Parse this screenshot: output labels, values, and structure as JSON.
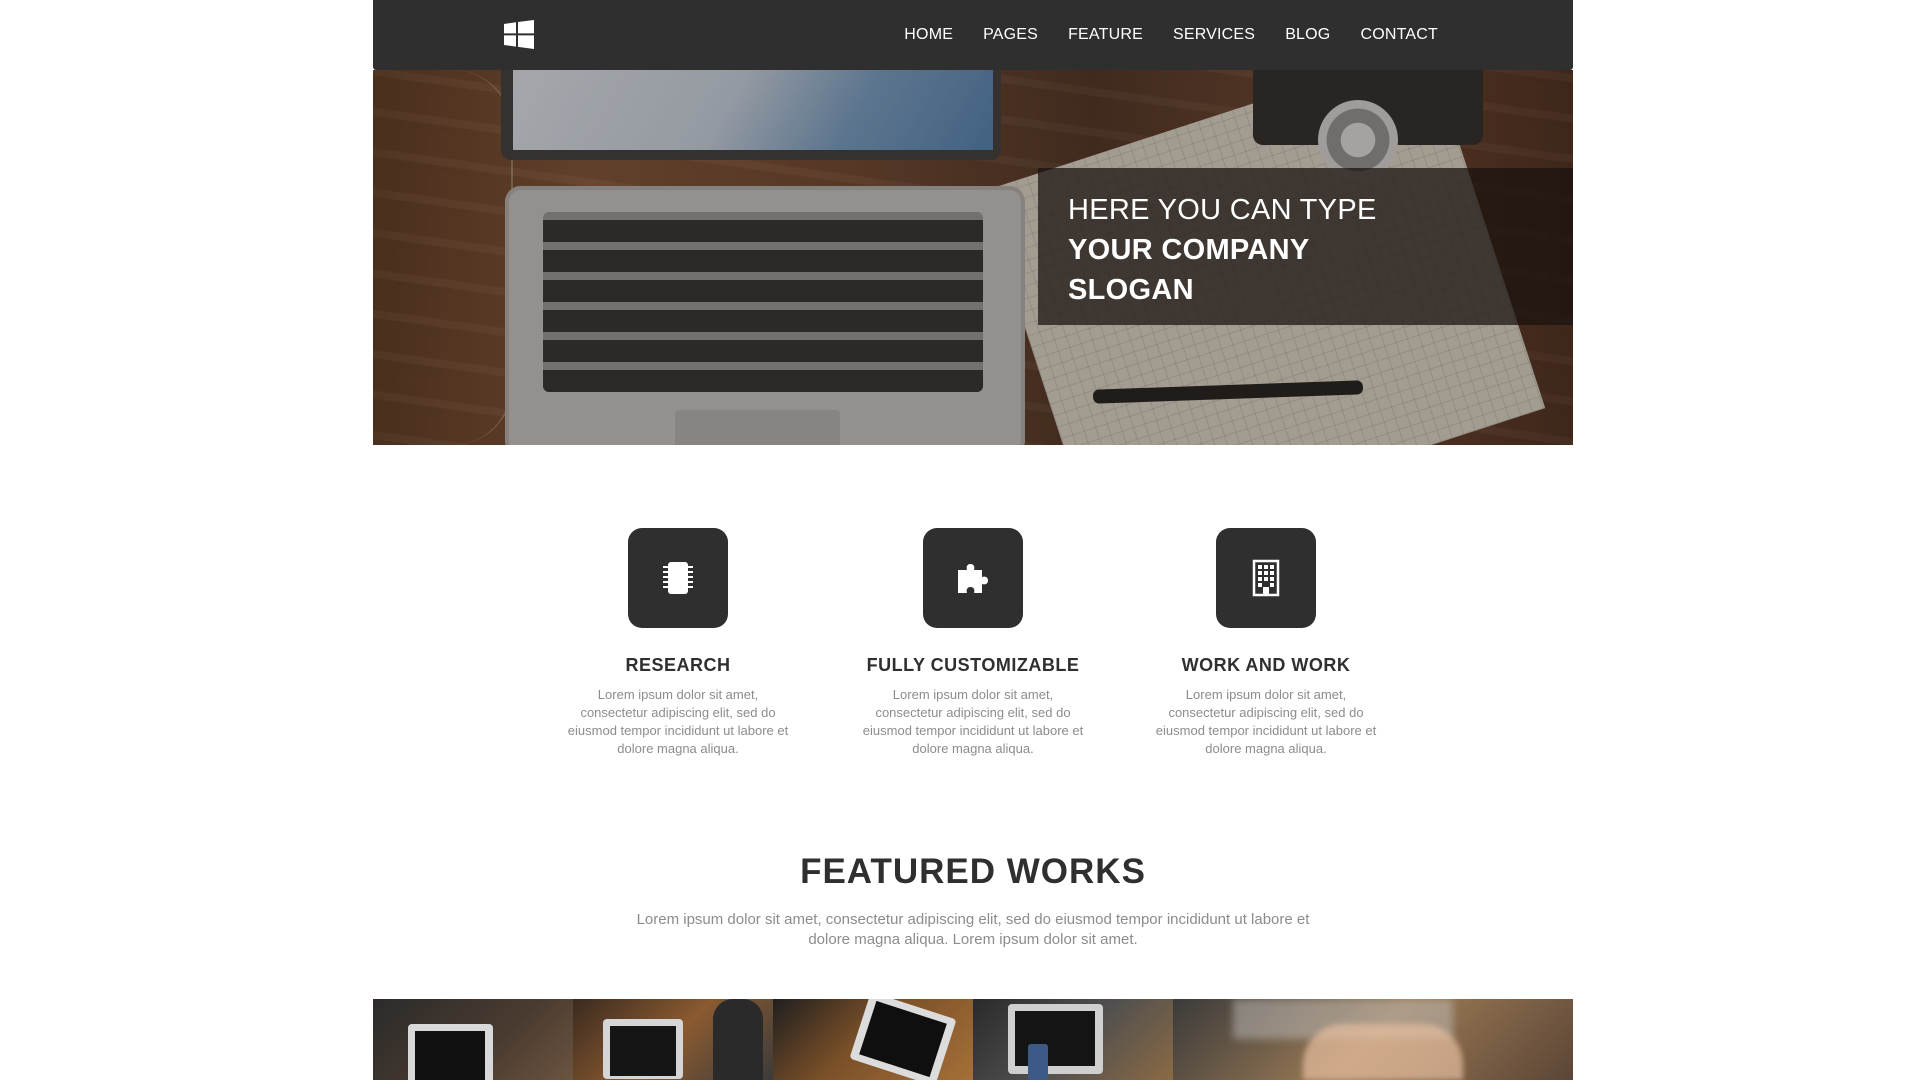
{
  "nav": {
    "logo_icon": "windows-logo-icon",
    "items": [
      {
        "label": "HOME"
      },
      {
        "label": "PAGES"
      },
      {
        "label": "FEATURE"
      },
      {
        "label": "SERVICES"
      },
      {
        "label": "BLOG"
      },
      {
        "label": "CONTACT"
      }
    ]
  },
  "hero": {
    "slogan_line1": "HERE YOU CAN TYPE",
    "slogan_line2": "YOUR COMPANY",
    "slogan_line3": "SLOGAN"
  },
  "features": [
    {
      "icon": "chip-icon",
      "title": "RESEARCH",
      "text": "Lorem ipsum dolor sit amet, consectetur adipiscing elit, sed do eiusmod tempor incididunt ut labore et dolore magna aliqua."
    },
    {
      "icon": "puzzle-icon",
      "title": "FULLY CUSTOMIZABLE",
      "text": "Lorem ipsum dolor sit amet, consectetur adipiscing elit, sed do eiusmod tempor incididunt ut labore et dolore magna aliqua."
    },
    {
      "icon": "building-icon",
      "title": "WORK AND WORK",
      "text": "Lorem ipsum dolor sit amet, consectetur adipiscing elit, sed do eiusmod tempor incididunt ut labore et dolore magna aliqua."
    }
  ],
  "works": {
    "title": "FEATURED WORKS",
    "subtitle": "Lorem ipsum dolor sit amet, consectetur adipiscing elit, sed do eiusmod tempor incididunt ut labore et dolore magna aliqua. Lorem ipsum dolor sit amet."
  },
  "colors": {
    "dark": "#2f2f2f",
    "muted_text": "#8c8c8c",
    "white": "#ffffff"
  }
}
